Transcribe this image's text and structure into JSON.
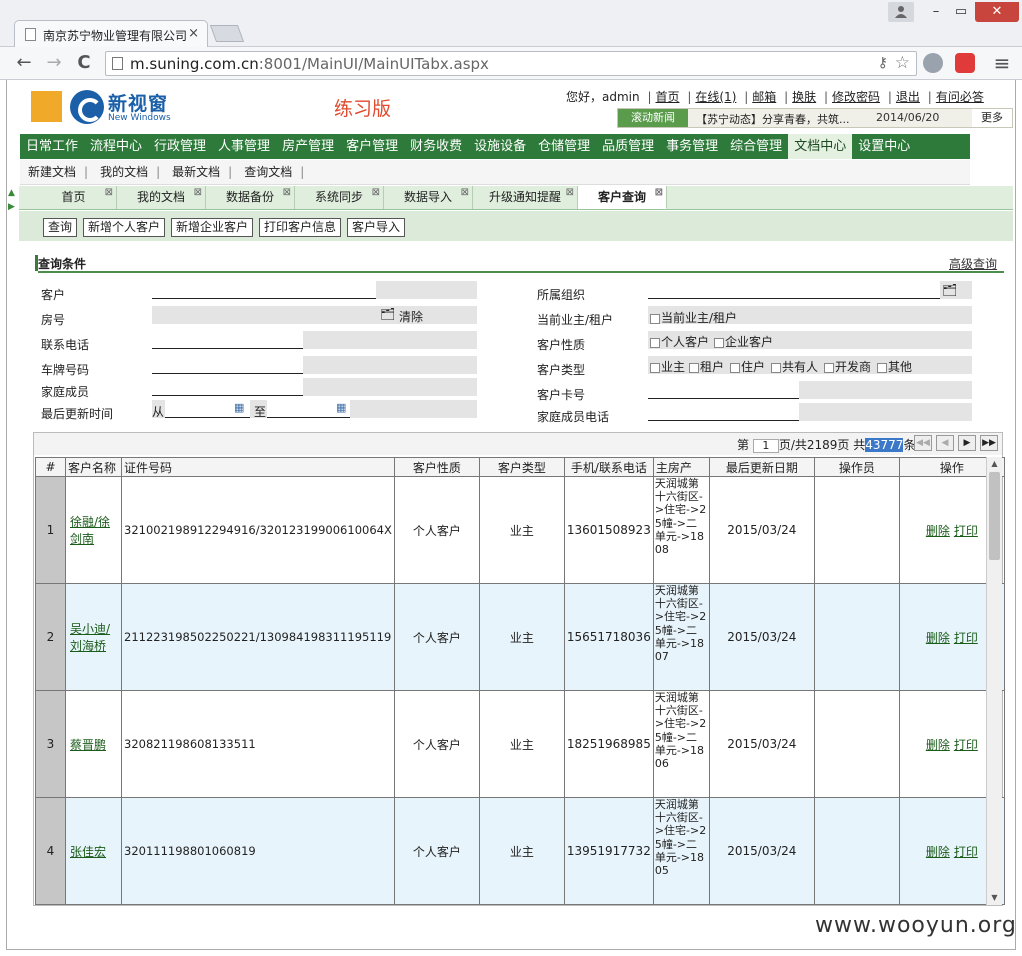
{
  "browser": {
    "tab_title": "南京苏宁物业管理有限公司",
    "tab_close": "×",
    "url_host": "m.suning.com.cn",
    "url_path": ":8001/MainUI/MainUITabx.aspx",
    "back": "←",
    "forward": "→",
    "reload": "C",
    "menu": "≡",
    "win_min": "–",
    "win_max": "▭",
    "win_close": "✕"
  },
  "header": {
    "logo_text": "新视窗",
    "logo_sub": "New Windows",
    "practice": "练习版",
    "greeting": "您好，admin",
    "links": [
      "首页",
      "在线(1)",
      "邮箱",
      "换肤",
      "修改密码",
      "退出",
      "有问必答"
    ],
    "news_label": "滚动新闻",
    "news_text": "【苏宁动态】分享青春，共筑...",
    "news_date": "2014/06/20",
    "news_more": "更多"
  },
  "main_menu": [
    "日常工作",
    "流程中心",
    "行政管理",
    "人事管理",
    "房产管理",
    "客户管理",
    "财务收费",
    "设施设备",
    "仓储管理",
    "品质管理",
    "事务管理",
    "综合管理",
    "文档中心",
    "设置中心"
  ],
  "main_menu_active": "文档中心",
  "sub_menu": [
    "新建文档",
    "我的文档",
    "最新文档",
    "查询文档"
  ],
  "work_tabs": [
    "首页",
    "我的文档",
    "数据备份",
    "系统同步",
    "数据导入",
    "升级通知提醒",
    "客户查询"
  ],
  "work_tab_active": "客户查询",
  "buttons": [
    "查询",
    "新增个人客户",
    "新增企业客户",
    "打印客户信息",
    "客户导入"
  ],
  "query": {
    "title": "查询条件",
    "advanced": "高级查询",
    "left_labels": [
      "客户",
      "房号",
      "联系电话",
      "车牌号码",
      "家庭成员",
      "最后更新时间"
    ],
    "right_labels": [
      "所属组织",
      "当前业主/租户",
      "客户性质",
      "客户类型",
      "客户卡号",
      "家庭成员电话"
    ],
    "clear": "清除",
    "from": "从",
    "to": "至",
    "owner_cb": "当前业主/租户",
    "nature_opts": [
      "个人客户",
      "企业客户"
    ],
    "type_opts": [
      "业主",
      "租户",
      "住户",
      "共有人",
      "开发商",
      "其他"
    ]
  },
  "pager": {
    "prefix": "第",
    "page": "1",
    "mid": "页/共2189页 共",
    "total": "43777",
    "suffix": "条"
  },
  "table": {
    "headers": [
      "#",
      "客户名称",
      "证件号码",
      "客户性质",
      "客户类型",
      "手机/联系电话",
      "主房产",
      "最后更新日期",
      "操作员",
      "操作"
    ],
    "op_delete": "删除",
    "op_print": "打印",
    "rows": [
      {
        "idx": "1",
        "name": "徐融/徐剑南",
        "id": "321002198912294916/32012319900610064X",
        "nature": "个人客户",
        "type": "业主",
        "phone": "13601508923",
        "room": "天润城第十六街区->住宅->25幢->二单元->1808",
        "date": "2015/03/24",
        "operator": ""
      },
      {
        "idx": "2",
        "name": "吴小迪/刘海桥",
        "id": "211223198502250221/130984198311195119",
        "nature": "个人客户",
        "type": "业主",
        "phone": "15651718036",
        "room": "天润城第十六街区->住宅->25幢->二单元->1807",
        "date": "2015/03/24",
        "operator": ""
      },
      {
        "idx": "3",
        "name": "蔡晋鹏",
        "id": "320821198608133511",
        "nature": "个人客户",
        "type": "业主",
        "phone": "18251968985",
        "room": "天润城第十六街区->住宅->25幢->二单元->1806",
        "date": "2015/03/24",
        "operator": ""
      },
      {
        "idx": "4",
        "name": "张佳宏",
        "id": "320111198801060819",
        "nature": "个人客户",
        "type": "业主",
        "phone": "13951917732",
        "room": "天润城第十六街区->住宅->25幢->二单元->1805",
        "date": "2015/03/24",
        "operator": ""
      }
    ]
  },
  "watermark": "www.wooyun.org",
  "colors": {
    "menu_green": "#2e7a3a",
    "logo_blue": "#1a5fa8",
    "practice_red": "#e04a2e",
    "row_alt": "#e8f4fb"
  }
}
